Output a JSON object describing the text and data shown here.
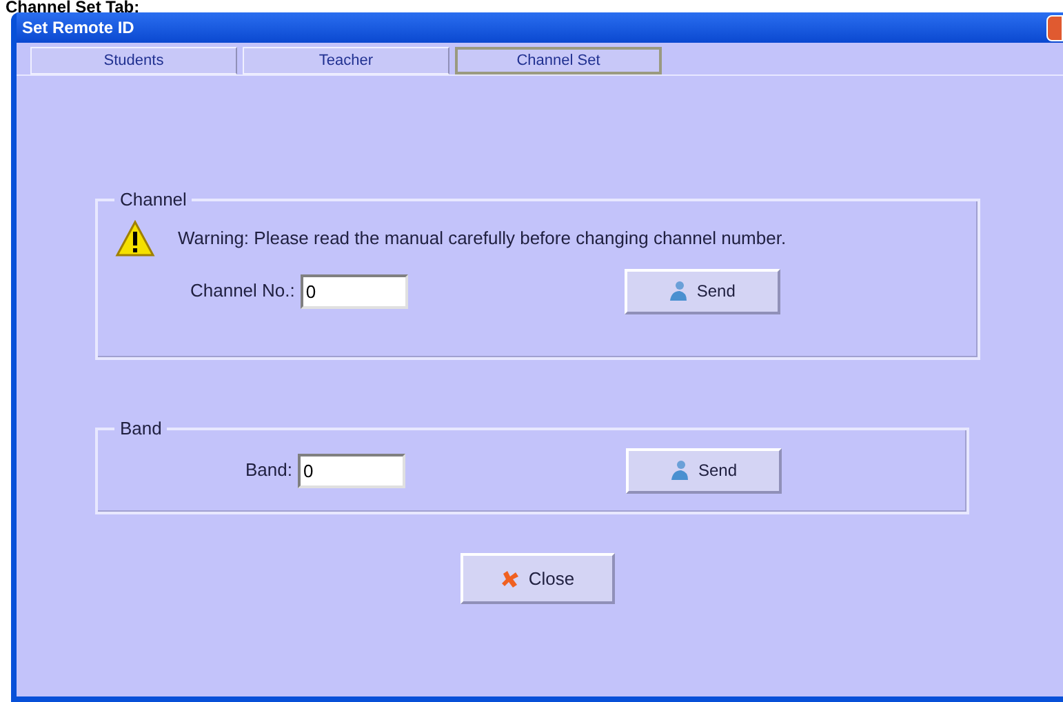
{
  "caption": "Channel Set Tab:",
  "window": {
    "title": "Set Remote ID"
  },
  "tabs": [
    {
      "label": "Students",
      "selected": false
    },
    {
      "label": "Teacher",
      "selected": false
    },
    {
      "label": "Channel Set",
      "selected": true
    }
  ],
  "channel_group": {
    "title": "Channel",
    "warning": "Warning: Please read the manual carefully before changing channel number.",
    "field_label": "Channel No.:",
    "value": "0",
    "button": "Send"
  },
  "band_group": {
    "title": "Band",
    "field_label": "Band:",
    "value": "0",
    "button": "Send"
  },
  "close_button": "Close"
}
